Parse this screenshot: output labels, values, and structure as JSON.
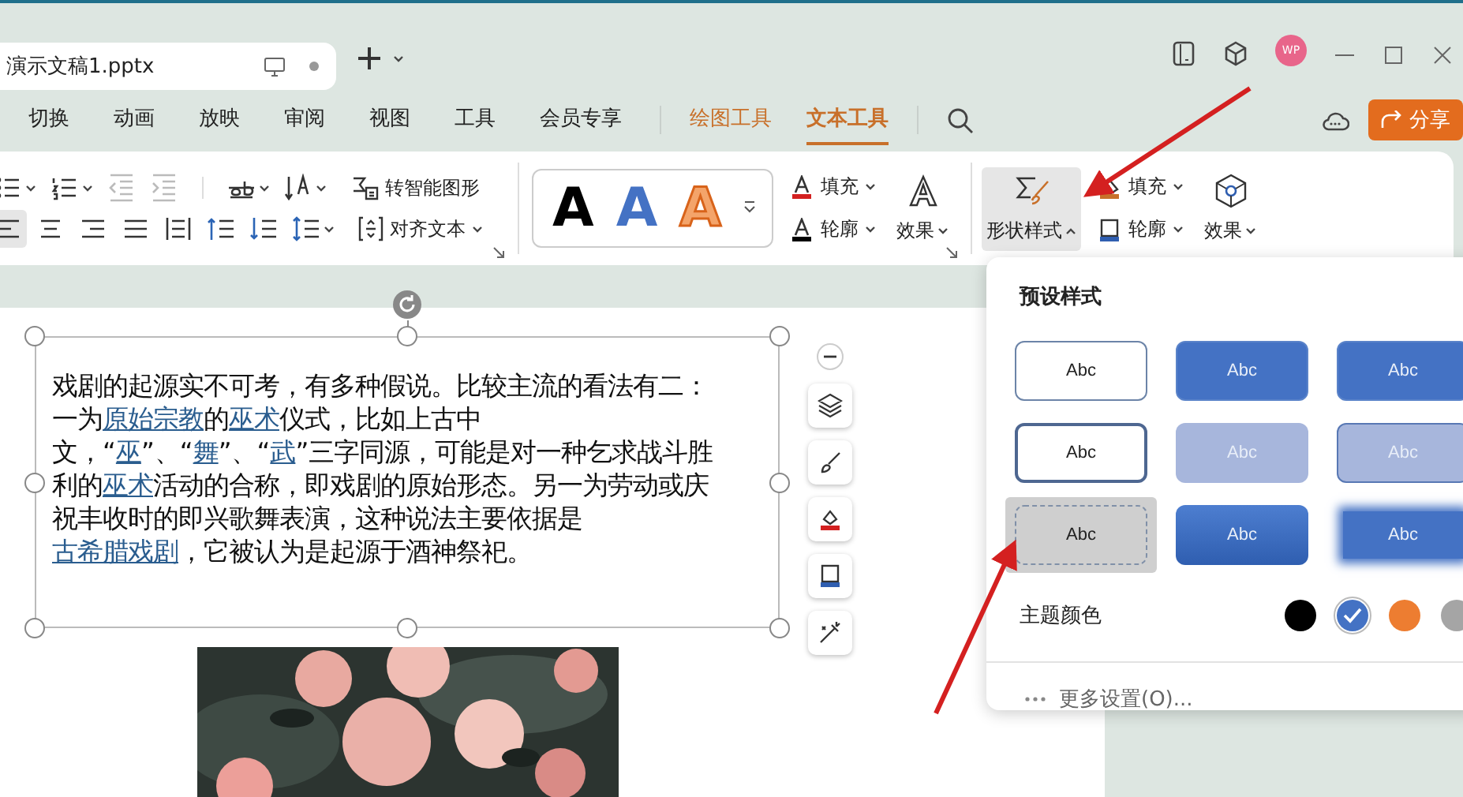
{
  "title_bar": {
    "document_tab": "演示文稿1.pptx",
    "avatar": "WP"
  },
  "menu_tabs": [
    {
      "label": "切换",
      "kind": "main",
      "selected": false
    },
    {
      "label": "动画",
      "kind": "main",
      "selected": false
    },
    {
      "label": "放映",
      "kind": "main",
      "selected": false
    },
    {
      "label": "审阅",
      "kind": "main",
      "selected": false
    },
    {
      "label": "视图",
      "kind": "main",
      "selected": false
    },
    {
      "label": "工具",
      "kind": "main",
      "selected": false
    },
    {
      "label": "会员专享",
      "kind": "main",
      "selected": false
    },
    {
      "label": "绘图工具",
      "kind": "context",
      "selected": false
    },
    {
      "label": "文本工具",
      "kind": "context",
      "selected": true
    }
  ],
  "share_button": "分享",
  "ribbon": {
    "paragraph_row_1": [
      {
        "kind": "bullets",
        "disabled": false
      },
      {
        "kind": "numbering",
        "disabled": false
      },
      {
        "kind": "outdent",
        "disabled": true
      },
      {
        "kind": "indent",
        "disabled": true
      },
      {
        "kind": "strike",
        "disabled": false
      },
      {
        "kind": "direction",
        "disabled": false
      }
    ],
    "smart_art_button": "转智能图形",
    "paragraph_row_2": [
      {
        "kind": "align-left",
        "selected": true
      },
      {
        "kind": "align-center",
        "selected": false
      },
      {
        "kind": "align-right",
        "selected": false
      },
      {
        "kind": "justify",
        "selected": false
      },
      {
        "kind": "distribute",
        "selected": false
      },
      {
        "kind": "spacing-up",
        "selected": false
      },
      {
        "kind": "spacing-down",
        "selected": false
      },
      {
        "kind": "line-spacing",
        "selected": false
      }
    ],
    "align_text_button": "对齐文本",
    "wordart_samples": [
      {
        "letter": "A",
        "kind": "black"
      },
      {
        "letter": "A",
        "kind": "blue"
      },
      {
        "letter": "A",
        "kind": "orange-outline"
      }
    ],
    "text_fill": "填充",
    "text_outline": "轮廓",
    "text_effect": "效果",
    "shape_style_button": {
      "label": "形状样式",
      "selected": true
    },
    "shape_fill": "填充",
    "shape_outline": "轮廓",
    "shape_effect": "效果"
  },
  "textbox": {
    "segments": [
      {
        "text": "戏剧的起源实不可考，有多种假说。比较主流的看法有二：一为",
        "link": false
      },
      {
        "text": "原始宗教",
        "link": true
      },
      {
        "text": "的",
        "link": false
      },
      {
        "text": "巫术",
        "link": true
      },
      {
        "text": "仪式，比如上古中文，“",
        "link": false
      },
      {
        "text": "巫",
        "link": true
      },
      {
        "text": "”、“",
        "link": false
      },
      {
        "text": "舞",
        "link": true
      },
      {
        "text": "”、“",
        "link": false
      },
      {
        "text": "武",
        "link": true
      },
      {
        "text": "”三字同源，可能是对一种乞求战斗胜利的",
        "link": false
      },
      {
        "text": "巫术",
        "link": true
      },
      {
        "text": "活动的合称，即戏剧的原始形态。另一为劳动或庆祝丰收时的即兴歌舞表演，这种说法主要依据是",
        "link": false
      },
      {
        "text": "古希腊戏剧",
        "link": true
      },
      {
        "text": "，它被认为是起源于酒神祭祀。",
        "link": false
      }
    ]
  },
  "style_panel": {
    "title": "预设样式",
    "presets": [
      {
        "label": "Abc",
        "kind": "outline",
        "selected": false
      },
      {
        "label": "Abc",
        "kind": "filled",
        "selected": false
      },
      {
        "label": "Abc",
        "kind": "filled",
        "selected": false
      },
      {
        "label": "Abc",
        "kind": "thick-outline",
        "selected": false
      },
      {
        "label": "Abc",
        "kind": "light",
        "selected": false
      },
      {
        "label": "Abc",
        "kind": "light-bordered",
        "selected": false
      },
      {
        "label": "Abc",
        "kind": "dashed",
        "selected": true
      },
      {
        "label": "Abc",
        "kind": "gradient",
        "selected": false
      },
      {
        "label": "Abc",
        "kind": "soft-edge",
        "selected": false
      }
    ],
    "theme_colors_label": "主题颜色",
    "theme_colors": [
      {
        "color": "#000000",
        "selected": false
      },
      {
        "color": "#4472c4",
        "selected": true
      },
      {
        "color": "#ed7d31",
        "selected": false
      },
      {
        "color": "#a5a5a5",
        "selected": false
      }
    ],
    "more_settings": "更多设置(O)..."
  }
}
